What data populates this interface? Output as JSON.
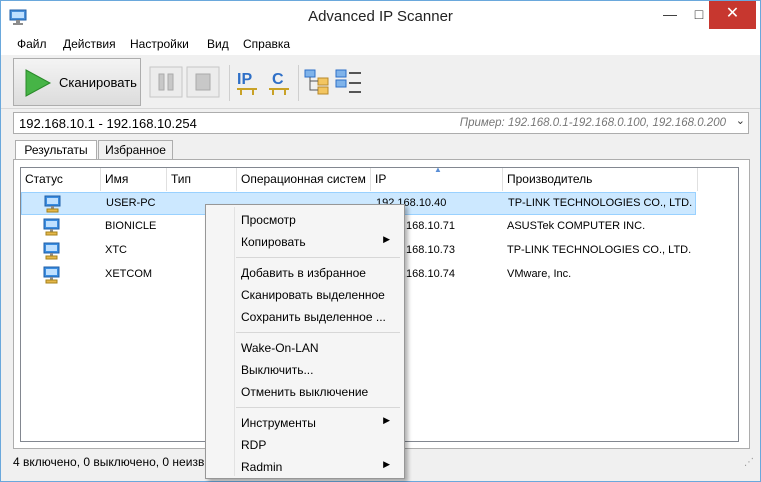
{
  "window": {
    "title": "Advanced IP Scanner"
  },
  "menu": [
    "Файл",
    "Действия",
    "Настройки",
    "Вид",
    "Справка"
  ],
  "toolbar": {
    "scan_label": "Сканировать"
  },
  "range": {
    "value": "192.168.10.1 - 192.168.10.254",
    "hint": "Пример: 192.168.0.1-192.168.0.100, 192.168.0.200"
  },
  "tabs": [
    "Результаты",
    "Избранное"
  ],
  "table": {
    "headers": [
      "Статус",
      "Имя",
      "Тип",
      "Операционная систем",
      "IP",
      "Производитель"
    ],
    "rows": [
      {
        "name": "USER-PC",
        "ip": "192.168.10.40",
        "vendor": "TP-LINK TECHNOLOGIES CO., LTD."
      },
      {
        "name": "BIONICLE",
        "ip": ".168.10.71",
        "vendor": "ASUSTek COMPUTER INC."
      },
      {
        "name": "XTC",
        "ip": ".168.10.73",
        "vendor": "TP-LINK TECHNOLOGIES CO., LTD."
      },
      {
        "name": "XETCOM",
        "ip": ".168.10.74",
        "vendor": "VMware, Inc."
      }
    ]
  },
  "status": {
    "text": "4 включено, 0 выключено, 0 неизв"
  },
  "context_menu": {
    "items": [
      "Просмотр",
      "Копировать",
      "Добавить в избранное",
      "Сканировать выделенное",
      "Сохранить выделенное ...",
      "Wake-On-LAN",
      "Выключить...",
      "Отменить выключение",
      "Инструменты",
      "RDP",
      "Radmin"
    ]
  },
  "colors": {
    "accent": "#2e7fd6",
    "selection": "#cce8ff",
    "close_button": "#c7372f",
    "scan_play": "#3aa83a"
  }
}
